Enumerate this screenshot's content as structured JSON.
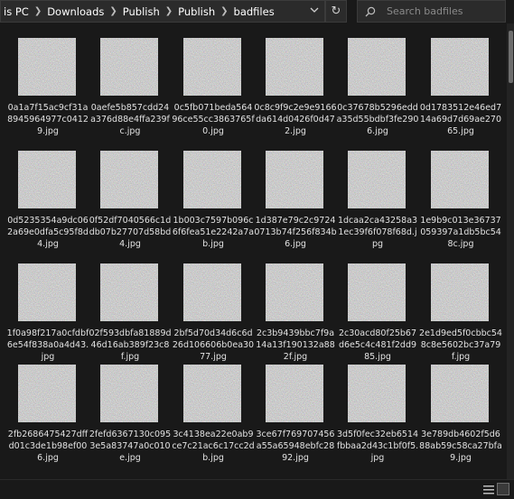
{
  "breadcrumb": [
    "is PC",
    "Downloads",
    "Publish",
    "Publish",
    "badfiles"
  ],
  "search": {
    "placeholder": "Search badfiles"
  },
  "files": [
    {
      "name": "0a1a7f15ac9cf31a8945964977c04129.jpg"
    },
    {
      "name": "0aefe5b857cdd24a376d88e4ffa239fc.jpg"
    },
    {
      "name": "0c5fb071beda56496ce55cc3863765f0.jpg"
    },
    {
      "name": "0c8c9f9c2e9e9166da614d0426f0d472.jpg"
    },
    {
      "name": "0c37678b5296edda35d55bdbf3fe2906.jpg"
    },
    {
      "name": "0d1783512e46ed714a69d7d69ae27065.jpg"
    },
    {
      "name": "0d5235354a9dc062a69e0dfa5c95f8d4.jpg"
    },
    {
      "name": "0f52df7040566c1ddb07b27707d58bd4.jpg"
    },
    {
      "name": "1b003c7597b096c6f6fea51e2242a7ab.jpg"
    },
    {
      "name": "1d387e79c2c97240713b74f256f834b6.jpg"
    },
    {
      "name": "1dcaa2ca43258a31ec39f6f078f68d.jpg"
    },
    {
      "name": "1e9b9c013e36737059397a1db5bc548c.jpg"
    },
    {
      "name": "1f0a98f217a0cfdbf6e54f838a0a4d43.jpg"
    },
    {
      "name": "02f593dbfa81889d46d16ab389f23c8f.jpg"
    },
    {
      "name": "2bf5d70d34d6c6d26d106606b0ea3077.jpg"
    },
    {
      "name": "2c3b9439bbc7f9a14a13f190132a882f.jpg"
    },
    {
      "name": "2c30acd80f25b67d6e5c4c481f2dd985.jpg"
    },
    {
      "name": "2e1d9ed5f0cbbc548c8e5602bc37a79f.jpg"
    },
    {
      "name": "2fb2686475427dffd01c3de1b98ef006.jpg"
    },
    {
      "name": "2fefd6367130c0953e5a83747a0c010e.jpg"
    },
    {
      "name": "3c4138ea22e0ab9ce7c21ac6c17cc2db.jpg"
    },
    {
      "name": "3ce67f769707456a55a65948ebfc2892.jpg"
    },
    {
      "name": "3d5f0fec32eb6514fbbaa2d43c1bf0f5.jpg"
    },
    {
      "name": "3e789db4602f5d688ab59c58ca27bfa9.jpg"
    }
  ],
  "colors": {
    "background": "#191919",
    "thumbnail": "#7b7b7b",
    "text": "#e2e2e2"
  }
}
